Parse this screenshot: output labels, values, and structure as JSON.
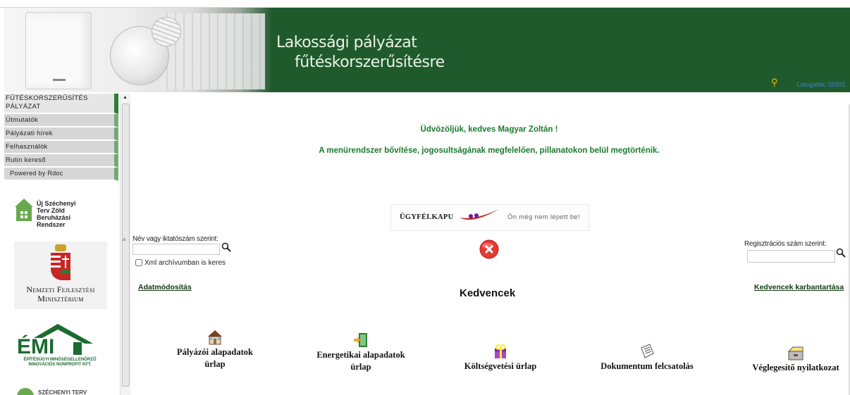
{
  "header": {
    "title_line1": "Lakossági pályázat",
    "title_line2": "fűtéskorszerűsítésre",
    "visitor_text": "Látogatók: 55891"
  },
  "sidebar": {
    "items": [
      {
        "label": "FŰTÉSKORSZERŰSÍTÉS PÁLYÁZAT"
      },
      {
        "label": "Útmutatók"
      },
      {
        "label": "Pályázati hírek"
      },
      {
        "label": "Felhasználók"
      },
      {
        "label": "Rutin kereső"
      },
      {
        "label": "Powered by Rdoc"
      }
    ],
    "logos": {
      "uszt": "Új Széchenyi Terv Zöld Beruházási Rendszer",
      "nfm_line1": "Nemzeti Fejlesztési",
      "nfm_line2": "Minisztérium",
      "emi": "ÉPÍTÉSÜGYI MINŐSÉGELLENŐRZŐ INNOVÁCIÓS NONPROFIT KFT.",
      "szechenyi": "SZÉCHENYI TERV"
    }
  },
  "main": {
    "welcome": "Üdvözöljük, kedves Magyar Zoltán !",
    "info": "A menürendszer bővítése, jogosultságának megfelelően, pillanatokon belül megtörténik.",
    "ugyfelkapu": {
      "name": "ÜGYFÉLKAPU",
      "status": "Ön még nem lépett be!"
    },
    "search_left": {
      "label": "Név vagy iktatószám szerint:",
      "value": ""
    },
    "xml_checkbox": {
      "label": "Xml archívumban is keres",
      "checked": false
    },
    "search_right": {
      "label": "Regisztrációs szám szerint:",
      "value": ""
    },
    "adatmodositas": "Adatmódosítás",
    "kedvencek_title": "Kedvencek",
    "kedvencek_link": "Kedvencek karbantartása",
    "favorites": [
      {
        "line1": "Pályázói alapadatok",
        "line2": "ürlap",
        "icon": "house-icon"
      },
      {
        "line1": "Energetikai alapadatok",
        "line2": "ürlap",
        "icon": "door-icon"
      },
      {
        "line1": "Költségvetési ürlap",
        "line2": "",
        "icon": "gift-box-icon"
      },
      {
        "line1": "Dokumentum felcsatolás",
        "line2": "",
        "icon": "document-icon"
      },
      {
        "line1": "Véglegesítő nyilatkozat",
        "line2": "",
        "icon": "archive-box-icon"
      }
    ]
  },
  "colors": {
    "header_green": "#1f5a2d",
    "text_green": "#1b7a2e",
    "menu_grey": "#d6d6d6",
    "menu_accent": "#74a877"
  }
}
